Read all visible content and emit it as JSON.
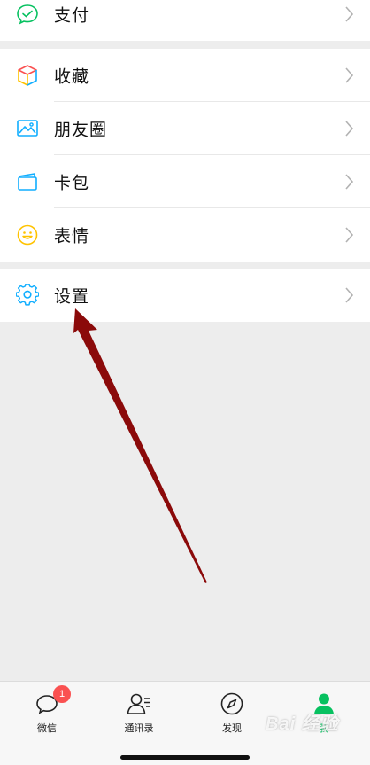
{
  "menu": {
    "pay": {
      "label": "支付",
      "icon": "pay-icon"
    },
    "favorites": {
      "label": "收藏",
      "icon": "favorites-cube-icon"
    },
    "moments": {
      "label": "朋友圈",
      "icon": "photo-icon"
    },
    "cards": {
      "label": "卡包",
      "icon": "card-icon"
    },
    "stickers": {
      "label": "表情",
      "icon": "smiley-icon"
    },
    "settings": {
      "label": "设置",
      "icon": "gear-icon"
    }
  },
  "tabbar": {
    "chats": {
      "label": "微信",
      "badge": "1"
    },
    "contacts": {
      "label": "通讯录"
    },
    "discover": {
      "label": "发现"
    },
    "me": {
      "label": "我"
    }
  },
  "watermark": "Bai 经验",
  "colors": {
    "accent": "#07c160",
    "badge": "#fa5151",
    "arrow": "#8b0a0a",
    "background": "#ededed"
  }
}
